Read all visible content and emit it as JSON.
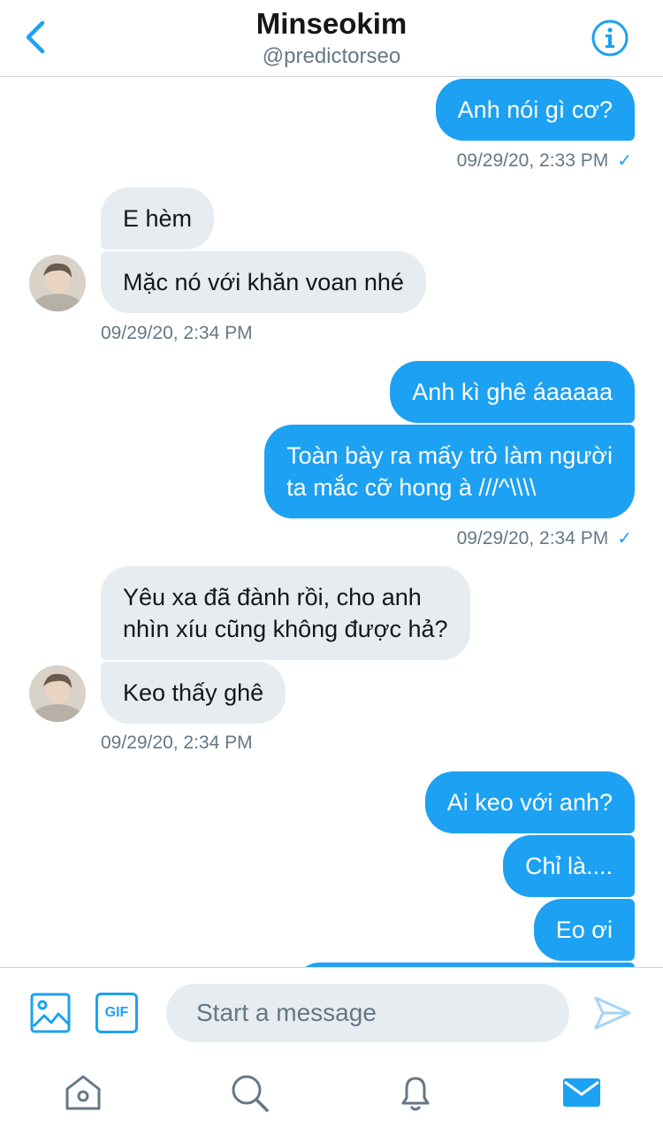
{
  "header": {
    "title": "Minseokim",
    "handle": "@predictorseo"
  },
  "messages": [
    {
      "side": "sent",
      "text": "Anh nói gì cơ?"
    },
    {
      "timestamp": "09/29/20, 2:33 PM",
      "side": "sent",
      "read": "✓"
    },
    {
      "side": "received",
      "text": "E hèm"
    },
    {
      "side": "received",
      "text": "Mặc nó với khăn voan nhé"
    },
    {
      "timestamp": "09/29/20, 2:34 PM",
      "side": "received"
    },
    {
      "side": "sent",
      "text": "Anh kì ghê áaaaaa"
    },
    {
      "side": "sent",
      "text_line1": "Toàn bày ra mấy trò làm người",
      "text_line2": "ta mắc cỡ hong à ///^\\\\\\\\"
    },
    {
      "timestamp": "09/29/20, 2:34 PM",
      "side": "sent",
      "read": "✓"
    },
    {
      "side": "received",
      "text_line1": "Yêu xa đã đành rồi, cho anh",
      "text_line2": "nhìn xíu cũng không được hả?"
    },
    {
      "side": "received",
      "text": "Keo thấy ghê"
    },
    {
      "timestamp": "09/29/20, 2:34 PM",
      "side": "received"
    },
    {
      "side": "sent",
      "text": "Ai keo với anh?"
    },
    {
      "side": "sent",
      "text": "Chỉ là...."
    },
    {
      "side": "sent",
      "text": "Eo ơi"
    }
  ],
  "composer": {
    "placeholder": "Start a message",
    "gif_label": "GIF"
  },
  "icons": {
    "back": "chevron-left-icon",
    "info": "info-icon",
    "image": "image-icon",
    "send": "send-icon",
    "home": "home-icon",
    "search": "search-icon",
    "notifications": "bell-icon",
    "messages": "mail-icon"
  },
  "colors": {
    "accent": "#1da1f2",
    "received_bubble": "#e6ecf0",
    "secondary_text": "#657786"
  }
}
